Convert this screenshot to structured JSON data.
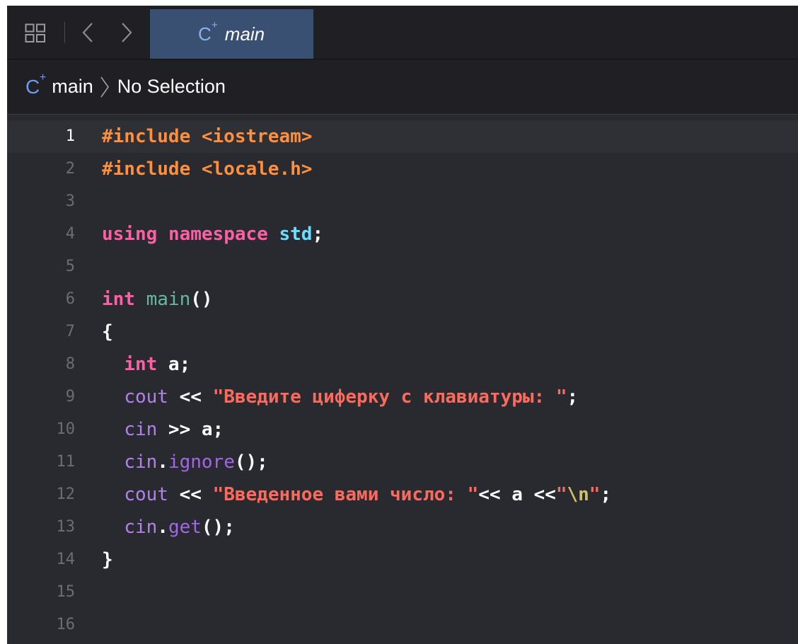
{
  "tab": {
    "label": "main",
    "icon": "cpp-file-icon"
  },
  "jumpbar": {
    "file": "main",
    "selection": "No Selection"
  },
  "icons": {
    "grid": "grid-icon",
    "back": "chevron-left-icon",
    "forward": "chevron-right-icon",
    "crumb_separator": "chevron-right-icon"
  },
  "colors": {
    "background": "#292a30",
    "tabbar": "#1f1f24",
    "active_tab": "#3a5073",
    "keyword": "#fc5fa3",
    "preprocessor": "#fd8f3f",
    "string": "#fc6a5d",
    "type": "#6bdfff",
    "function": "#67b7a4",
    "line_number": "#6c6c75"
  },
  "editor": {
    "current_line": 1,
    "lines": [
      {
        "n": "1",
        "tokens": [
          {
            "t": "#include <iostream>",
            "c": "pre"
          }
        ]
      },
      {
        "n": "2",
        "tokens": [
          {
            "t": "#include <locale.h>",
            "c": "pre"
          }
        ]
      },
      {
        "n": "3",
        "tokens": []
      },
      {
        "n": "4",
        "tokens": [
          {
            "t": "using",
            "c": "kw"
          },
          {
            "t": " "
          },
          {
            "t": "namespace",
            "c": "kw"
          },
          {
            "t": " "
          },
          {
            "t": "std",
            "c": "ty"
          },
          {
            "t": ";"
          }
        ]
      },
      {
        "n": "5",
        "tokens": []
      },
      {
        "n": "6",
        "tokens": [
          {
            "t": "int",
            "c": "kw"
          },
          {
            "t": " "
          },
          {
            "t": "main",
            "c": "fn"
          },
          {
            "t": "()"
          }
        ]
      },
      {
        "n": "7",
        "tokens": [
          {
            "t": "{"
          }
        ]
      },
      {
        "n": "8",
        "tokens": [
          {
            "t": "  "
          },
          {
            "t": "int",
            "c": "kw"
          },
          {
            "t": " a;"
          }
        ]
      },
      {
        "n": "9",
        "tokens": [
          {
            "t": "  "
          },
          {
            "t": "cout",
            "c": "var"
          },
          {
            "t": " << "
          },
          {
            "t": "\"Введите циферку с клавиатуры: \"",
            "c": "str"
          },
          {
            "t": ";"
          }
        ]
      },
      {
        "n": "10",
        "tokens": [
          {
            "t": "  "
          },
          {
            "t": "cin",
            "c": "var"
          },
          {
            "t": " >> a;"
          }
        ]
      },
      {
        "n": "11",
        "tokens": [
          {
            "t": "  "
          },
          {
            "t": "cin",
            "c": "var"
          },
          {
            "t": "."
          },
          {
            "t": "ignore",
            "c": "mth"
          },
          {
            "t": "();"
          }
        ]
      },
      {
        "n": "12",
        "tokens": [
          {
            "t": "  "
          },
          {
            "t": "cout",
            "c": "var"
          },
          {
            "t": " << "
          },
          {
            "t": "\"Введенное вами число: \"",
            "c": "str"
          },
          {
            "t": "<< a <<"
          },
          {
            "t": "\"",
            "c": "str"
          },
          {
            "t": "\\n",
            "c": "esc"
          },
          {
            "t": "\"",
            "c": "str"
          },
          {
            "t": ";"
          }
        ]
      },
      {
        "n": "13",
        "tokens": [
          {
            "t": "  "
          },
          {
            "t": "cin",
            "c": "var"
          },
          {
            "t": "."
          },
          {
            "t": "get",
            "c": "mth"
          },
          {
            "t": "();"
          }
        ]
      },
      {
        "n": "14",
        "tokens": [
          {
            "t": "}"
          }
        ]
      },
      {
        "n": "15",
        "tokens": []
      },
      {
        "n": "16",
        "tokens": []
      }
    ]
  }
}
